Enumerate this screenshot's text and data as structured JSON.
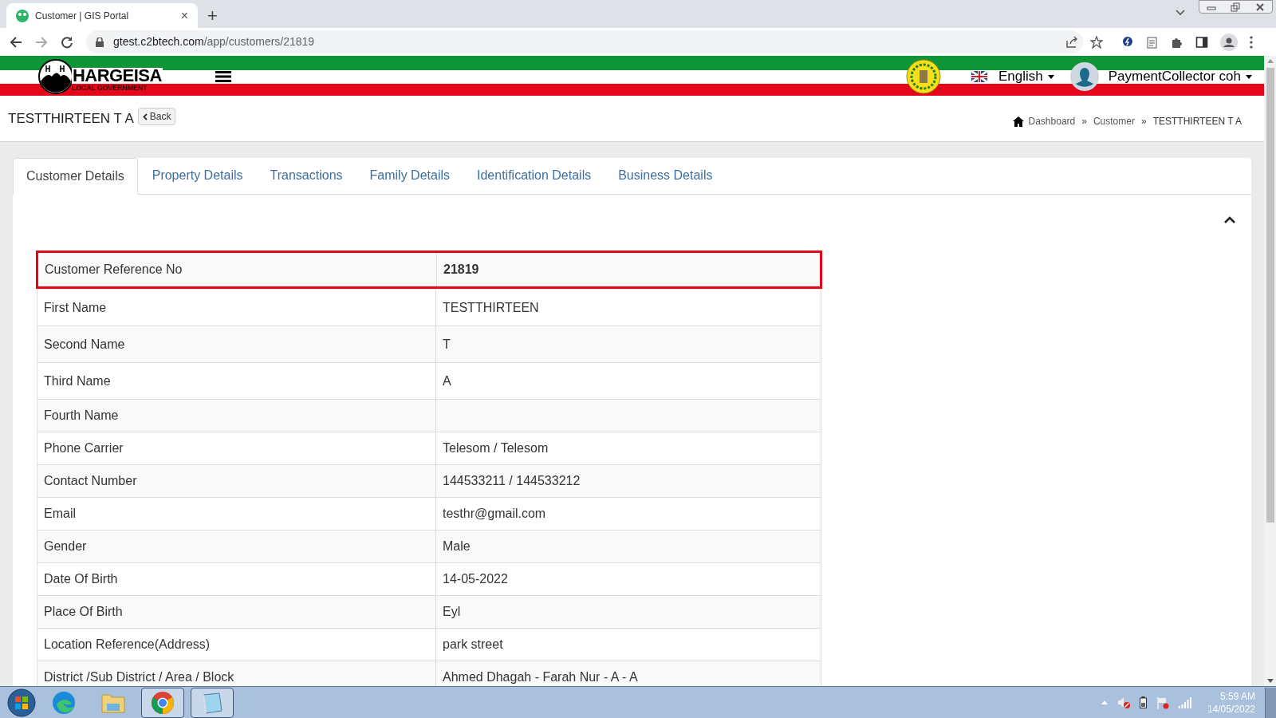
{
  "browser": {
    "tab_title": "Customer | GIS Portal",
    "tab_close": "×",
    "new_tab": "+",
    "url_host": "gtest.c2btech.com",
    "url_path": "/app/customers/21819"
  },
  "header": {
    "logo_title": "HARGEISA",
    "logo_subtitle": "LOCAL GOVERNMENT",
    "language": "English",
    "user": "PaymentCollector coh"
  },
  "page": {
    "title": "TESTTHIRTEEN T A",
    "back": "Back",
    "breadcrumb": [
      "Dashboard",
      "Customer",
      "TESTTHIRTEEN T A"
    ],
    "breadcrumb_separator": "»"
  },
  "tabs": [
    {
      "label": "Customer Details",
      "selected": true
    },
    {
      "label": "Property Details",
      "selected": false
    },
    {
      "label": "Transactions",
      "selected": false
    },
    {
      "label": "Family Details",
      "selected": false
    },
    {
      "label": "Identification Details",
      "selected": false
    },
    {
      "label": "Business Details",
      "selected": false
    }
  ],
  "table": {
    "rows": [
      {
        "label": "Customer Reference No",
        "value": "21819",
        "highlighted": true
      },
      {
        "label": "First Name",
        "value": "TESTTHIRTEEN",
        "highlighted": false
      },
      {
        "label": "Second Name",
        "value": "T",
        "highlighted": false
      },
      {
        "label": "Third Name",
        "value": "A",
        "highlighted": false
      },
      {
        "label": "Fourth Name",
        "value": "",
        "highlighted": false
      },
      {
        "label": "Phone Carrier",
        "value": "Telesom / Telesom",
        "highlighted": false
      },
      {
        "label": "Contact Number",
        "value": "144533211 / 144533212",
        "highlighted": false
      },
      {
        "label": "Email",
        "value": "testhr@gmail.com",
        "highlighted": false
      },
      {
        "label": "Gender",
        "value": "Male",
        "highlighted": false
      },
      {
        "label": "Date Of Birth",
        "value": "14-05-2022",
        "highlighted": false
      },
      {
        "label": "Place Of Birth",
        "value": "Eyl",
        "highlighted": false
      },
      {
        "label": "Location Reference(Address)",
        "value": "park street",
        "highlighted": false
      },
      {
        "label": "District /Sub District / Area / Block",
        "value": "Ahmed Dhagah - Farah Nur - A - A",
        "highlighted": false
      }
    ]
  },
  "taskbar": {
    "apps": [
      {
        "kind": "edge",
        "running": false
      },
      {
        "kind": "folder",
        "running": false
      },
      {
        "kind": "chrome",
        "running": true
      },
      {
        "kind": "notepad",
        "running": true
      }
    ],
    "time": "5:59 AM",
    "date": "14/05/2022"
  }
}
